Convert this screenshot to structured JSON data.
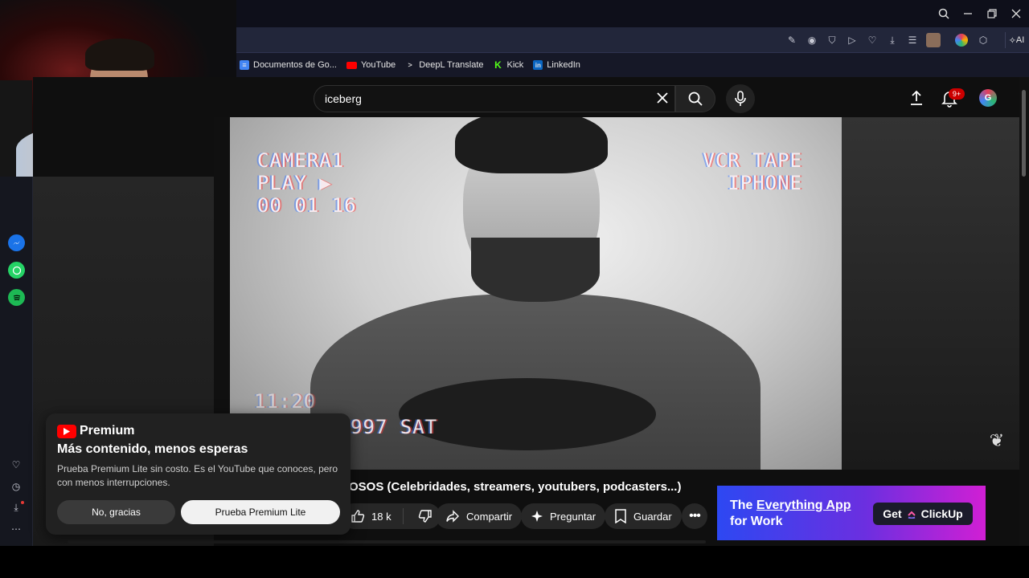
{
  "bookmarks": [
    {
      "label": "Documentos de Go...",
      "color": "#4285f4"
    },
    {
      "label": "YouTube",
      "color": "#ff0000"
    },
    {
      "label": "DeepL Translate",
      "color": "#0f2b46"
    },
    {
      "label": "Kick",
      "color": "#53fc18"
    },
    {
      "label": "LinkedIn",
      "color": "#0a66c2"
    }
  ],
  "toolbar": {
    "ai_label": "AI"
  },
  "search": {
    "query": "iceberg"
  },
  "notifications": {
    "badge": "9+"
  },
  "player": {
    "vhs_left": "CAMERA1\nPLAY ▶\n00 01 16",
    "vhs_right_1": "VCR TAPE",
    "vhs_right_2": "IPHONE",
    "vhs_time": "11:20",
    "vhs_date": "997 SAT"
  },
  "video": {
    "title_visible": "OSOS (Celebridades, streamers, youtubers, podcasters...)",
    "likes": "18 k",
    "share_label": "Compartir",
    "ask_label": "Preguntar",
    "save_label": "Guardar"
  },
  "ad": {
    "line1_prefix": "The ",
    "line1_highlight": "Everything App",
    "line2": "for Work",
    "cta_prefix": "Get",
    "cta_brand": "ClickUp"
  },
  "premium": {
    "brand": "Premium",
    "title": "Más contenido, menos esperas",
    "description": "Prueba Premium Lite sin costo. Es el YouTube que conoces, pero con menos interrupciones.",
    "decline_label": "No, gracias",
    "accept_label": "Prueba Premium Lite"
  },
  "icons": [
    "search-icon",
    "minimize-icon",
    "restore-icon",
    "close-icon",
    "messenger-icon",
    "whatsapp-icon",
    "spotify-icon",
    "heart-icon",
    "history-icon",
    "download-icon",
    "more-icon",
    "upload-icon",
    "bell-icon",
    "mic-icon",
    "like-icon",
    "dislike-icon",
    "share-icon",
    "sparkle-icon",
    "bookmark-icon"
  ]
}
